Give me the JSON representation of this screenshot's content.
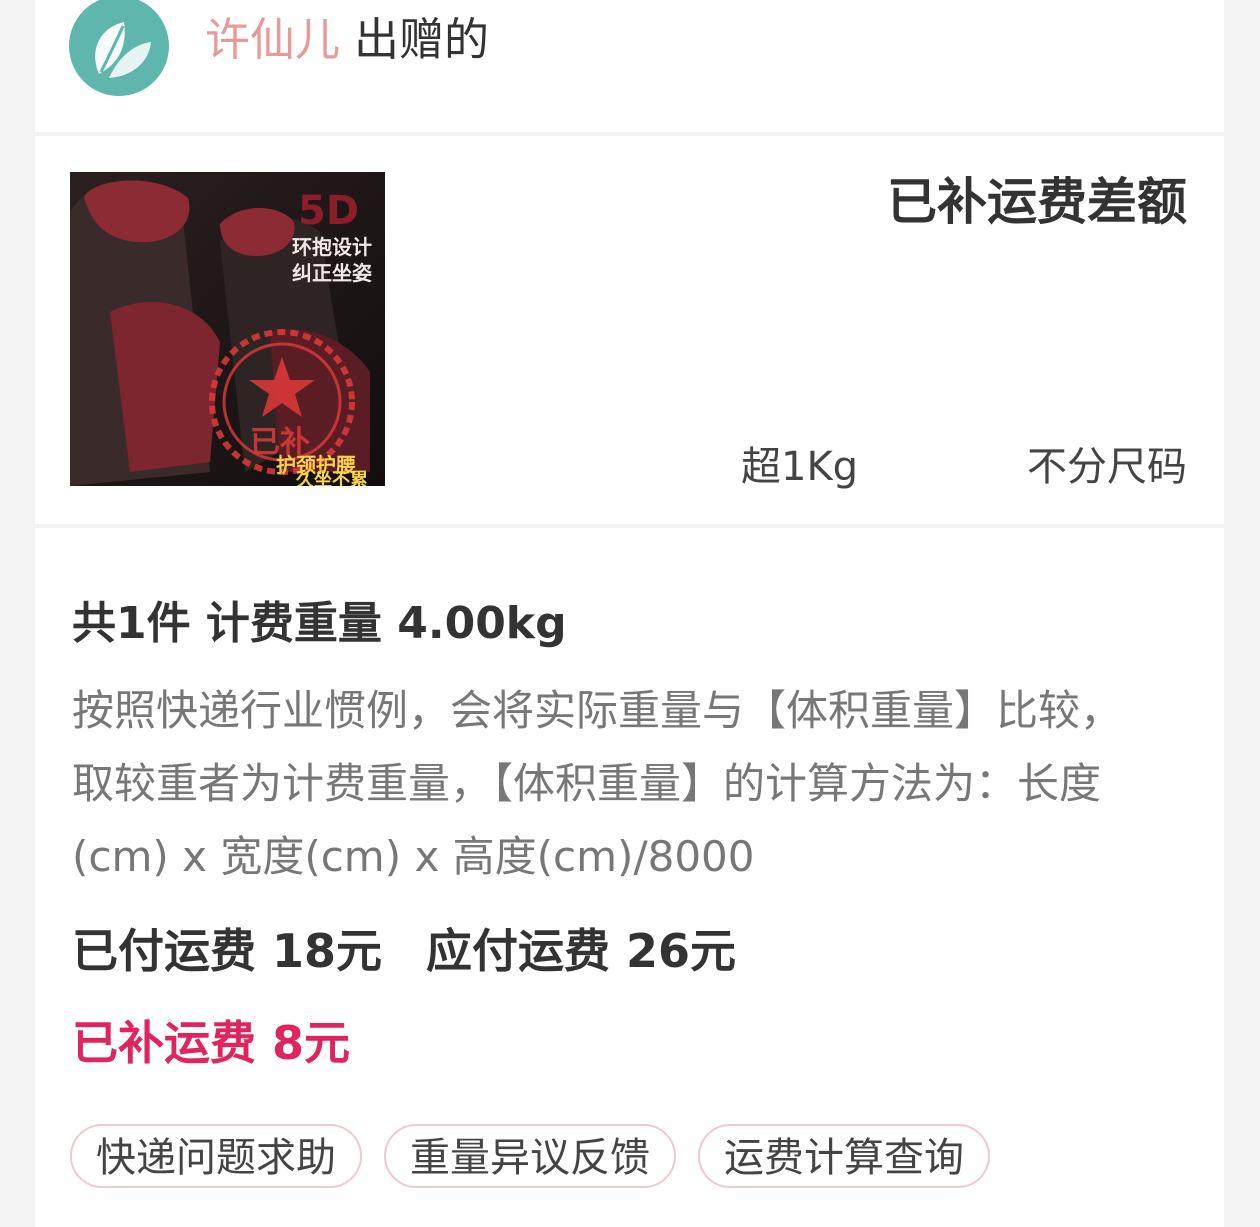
{
  "header": {
    "sender_name": "许仙儿",
    "sender_suffix": "出赠的",
    "avatar_icon": "leaf-avatar-icon"
  },
  "product": {
    "image_texts": {
      "badge": "5D",
      "line1": "环抱设计",
      "line2": "纠正坐姿",
      "stamp": "已补",
      "line3": "护颈护腰",
      "line4": "久坐不累"
    },
    "status_title": "已补运费差额",
    "spec_weight": "超1Kg",
    "spec_size": "不分尺码"
  },
  "details": {
    "summary": "共1件 计费重量 4.00kg",
    "explanation": "按照快递行业惯例，会将实际重量与【体积重量】比较，取较重者为计费重量，【体积重量】的计算方法为：长度(cm) x 宽度(cm) x 高度(cm)/8000",
    "paid_fee": "已付运费 18元",
    "due_fee": "应付运费 26元",
    "supplement_fee": "已补运费 8元"
  },
  "actions": {
    "help": "快递问题求助",
    "weight_feedback": "重量异议反馈",
    "fee_query": "运费计算查询"
  },
  "colors": {
    "accent": "#e0245e",
    "sender_name": "#e79a9a",
    "avatar_bg": "#5fb6ad",
    "button_border": "#f0c9cf"
  }
}
